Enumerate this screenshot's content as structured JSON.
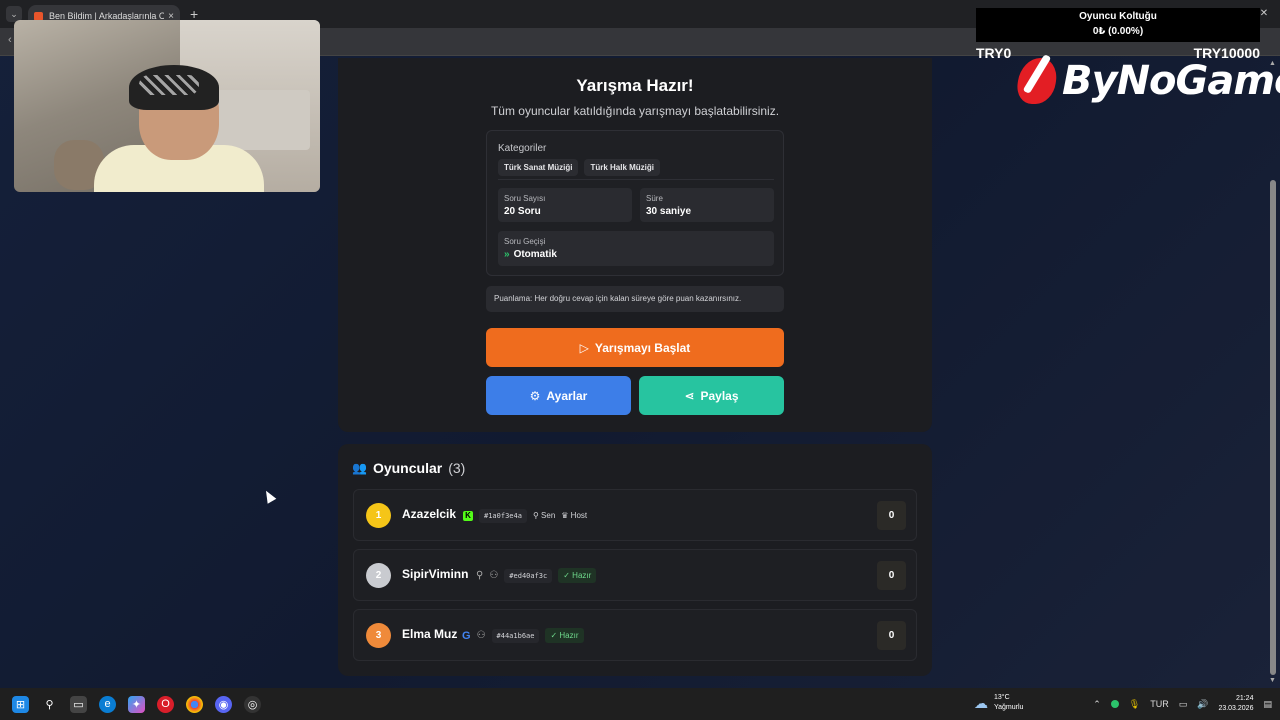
{
  "browser": {
    "tab_title": "Ben Bildim | Arkadaşlarınla Online",
    "tab_close": "×",
    "new_tab": "+",
    "menu_icon": "chevron-down-icon",
    "window_controls": [
      "—",
      "☐",
      "✕"
    ],
    "back": "‹"
  },
  "overlay": {
    "title": "Oyuncu Koltuğu",
    "value": "0₺ (0.00%)",
    "min": "TRY0",
    "max": "TRY10000",
    "logo_text": "ByNoGame"
  },
  "quiz": {
    "title": "Yarışma Hazır!",
    "subtitle": "Tüm oyuncular katıldığında yarışmayı başlatabilirsiniz.",
    "categories_label": "Kategoriler",
    "categories": [
      "Türk Sanat Müziği",
      "Türk Halk Müziği"
    ],
    "question_count_label": "Soru Sayısı",
    "question_count": "20 Soru",
    "duration_label": "Süre",
    "duration": "30 saniye",
    "transition_label": "Soru Geçişi",
    "transition": "Otomatik",
    "scoring_info": "Puanlama: Her doğru cevap için kalan süreye göre puan kazanırsınız.",
    "start_button": "Yarışmayı Başlat",
    "settings_button": "Ayarlar",
    "share_button": "Paylaş"
  },
  "players": {
    "title": "Oyuncular",
    "count": "(3)",
    "list": [
      {
        "rank": "1",
        "name": "Azazelcik",
        "id": "#1a0f3e4a",
        "tag1": "Sen",
        "tag2": "Host",
        "score": "0",
        "color": "#f5c518"
      },
      {
        "rank": "2",
        "name": "SipirViminn",
        "id": "#ed40af3c",
        "status": "Hazır",
        "score": "0",
        "color": "#c9cbd0"
      },
      {
        "rank": "3",
        "name": "Elma Muz",
        "id": "#44a1b6ae",
        "status": "Hazır",
        "score": "0",
        "color": "#ef8a3a"
      }
    ]
  },
  "taskbar": {
    "weather_temp": "13°C",
    "weather_desc": "Yağmurlu",
    "lang": "TUR",
    "time": "21:24",
    "date": "23.03.2026"
  },
  "colors": {
    "accent_orange": "#ef6c1e",
    "accent_blue": "#3d7ee8",
    "accent_teal": "#27c4a0",
    "ready_green": "#6fd98c"
  }
}
